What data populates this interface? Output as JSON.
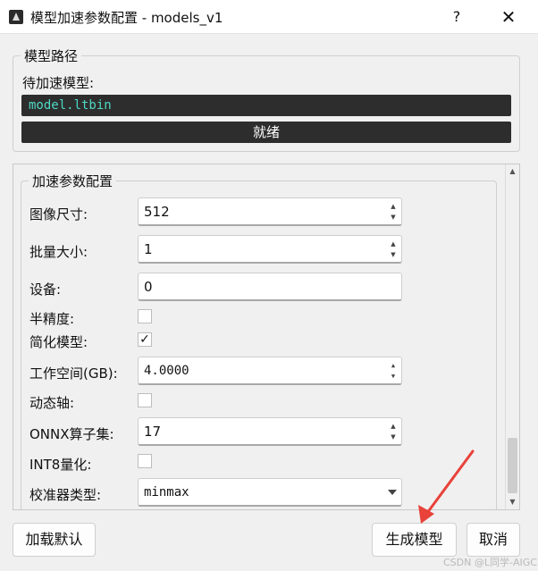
{
  "window": {
    "title": "模型加速参数配置 - models_v1",
    "help": "?",
    "close": "✕"
  },
  "model_group": {
    "title": "模型路径",
    "wait_label": "待加速模型:",
    "model_file": "model.ltbin",
    "status": "就绪"
  },
  "params": {
    "title": "加速参数配置",
    "image_size": {
      "label": "图像尺寸:",
      "value": "512"
    },
    "batch_size": {
      "label": "批量大小:",
      "value": "1"
    },
    "device": {
      "label": "设备:",
      "value": "0"
    },
    "half": {
      "label": "半精度:",
      "checked": false
    },
    "simplify": {
      "label": "简化模型:",
      "checked": true,
      "mark": "✓"
    },
    "workspace": {
      "label": "工作空间(GB):",
      "value": "4.0000"
    },
    "dynamic": {
      "label": "动态轴:",
      "checked": false
    },
    "opset": {
      "label": "ONNX算子集:",
      "value": "17"
    },
    "int8": {
      "label": "INT8量化:",
      "checked": false
    },
    "calibrator": {
      "label": "校准器类型:",
      "value": "minmax"
    }
  },
  "buttons": {
    "load_default": "加载默认",
    "generate": "生成模型",
    "cancel": "取消"
  },
  "watermark": "CSDN @L同学-AIGC",
  "colors": {
    "annotation_arrow": "#e8423a",
    "status_bg": "#2d2d2d",
    "model_file_text": "#4fd8c4"
  }
}
